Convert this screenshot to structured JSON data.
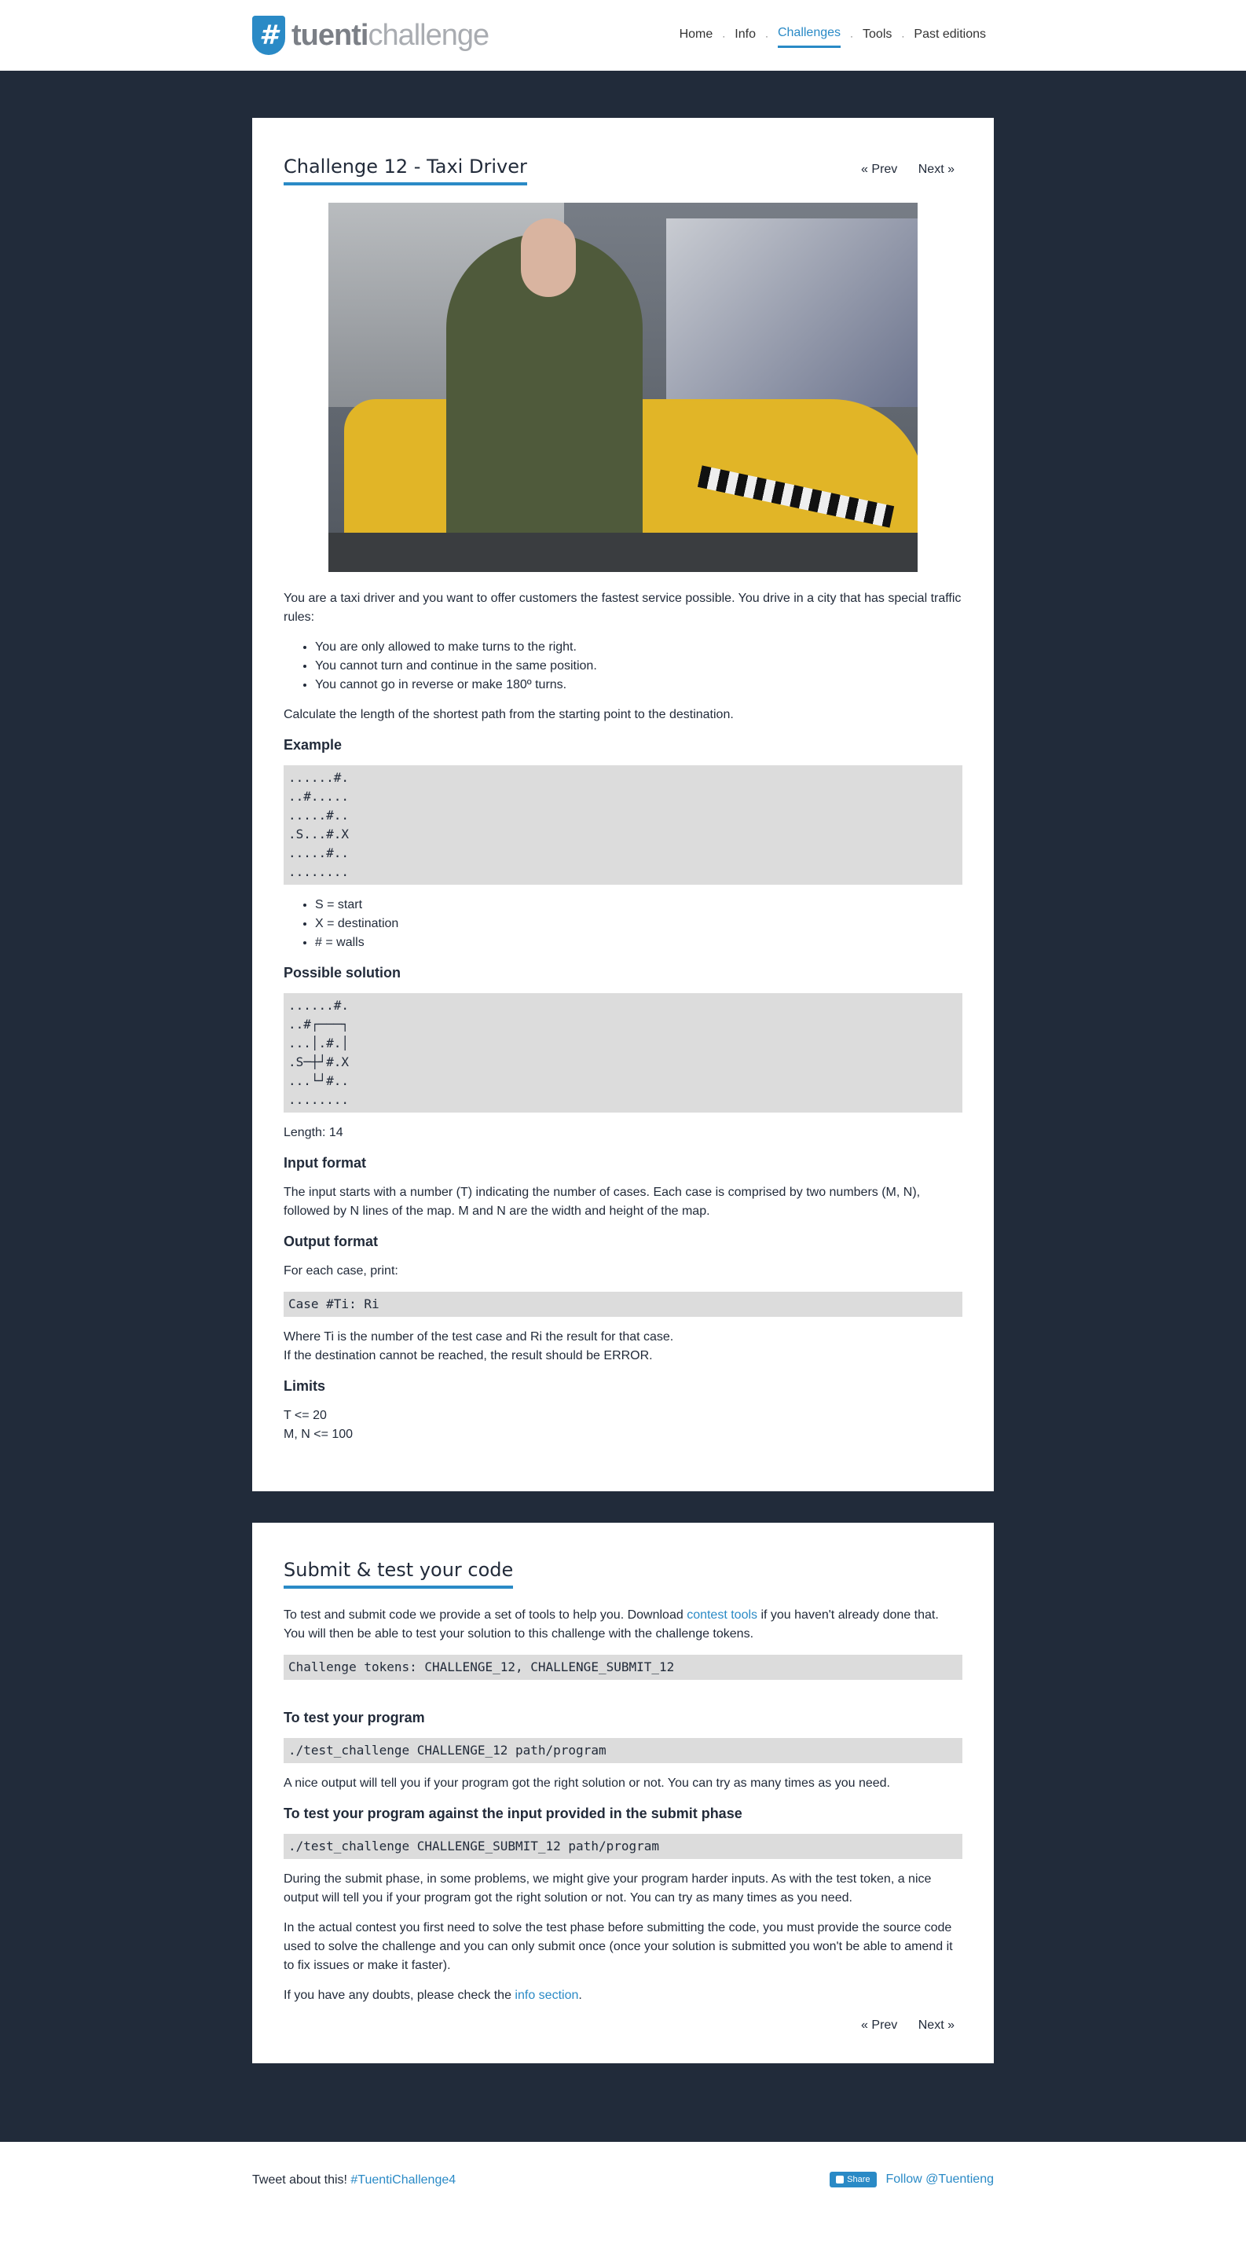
{
  "header": {
    "logo_text_bold": "tuenti",
    "logo_text_light": "challenge",
    "logo_symbol": "#",
    "nav": [
      {
        "label": "Home"
      },
      {
        "label": "Info"
      },
      {
        "label": "Challenges",
        "active": true
      },
      {
        "label": "Tools"
      },
      {
        "label": "Past editions"
      }
    ],
    "separator": "·"
  },
  "challenge": {
    "title": "Challenge 12 - Taxi Driver",
    "prev_label": "« Prev",
    "next_label": "Next »",
    "intro": "You are a taxi driver and you want to offer customers the fastest service possible. You drive in a city that has special traffic rules:",
    "rules": [
      "You are only allowed to make turns to the right.",
      "You cannot turn and continue in the same position.",
      "You cannot go in reverse or make 180º turns."
    ],
    "calc": "Calculate the length of the shortest path from the starting point to the destination.",
    "example_heading": "Example",
    "example_map": "......#.\n..#.....\n.....#..\n.S...#.X\n.....#..\n........",
    "legend": [
      "S = start",
      "X = destination",
      "# = walls"
    ],
    "solution_heading": "Possible solution",
    "solution_map": "......#.\n..#┌───┐\n...│.#.│\n.S─┼┘#.X\n...└┘#..\n........",
    "length": "Length: 14",
    "input_heading": "Input format",
    "input_text": "The input starts with a number (T) indicating the number of cases. Each case is comprised by two numbers (M, N), followed by N lines of the map. M and N are the width and height of the map.",
    "output_heading": "Output format",
    "output_text": "For each case, print:",
    "output_code": "Case #Ti: Ri",
    "where_text": "Where Ti is the number of the test case and Ri the result for that case.",
    "error_text": "If the destination cannot be reached, the result should be ERROR.",
    "limits_heading": "Limits",
    "limits": [
      "T <= 20",
      "M, N <= 100"
    ]
  },
  "submit": {
    "title": "Submit & test your code",
    "intro_before": "To test and submit code we provide a set of tools to help you. Download ",
    "intro_link": "contest tools",
    "intro_after": " if you haven't already done that. You will then be able to test your solution to this challenge with the challenge tokens.",
    "tokens_code": "Challenge tokens: CHALLENGE_12, CHALLENGE_SUBMIT_12",
    "test_heading": "To test your program",
    "test_code": "./test_challenge CHALLENGE_12 path/program",
    "test_text": "A nice output will tell you if your program got the right solution or not. You can try as many times as you need.",
    "submit_heading": "To test your program against the input provided in the submit phase",
    "submit_code": "./test_challenge CHALLENGE_SUBMIT_12 path/program",
    "submit_text": "During the submit phase, in some problems, we might give your program harder inputs. As with the test token, a nice output will tell you if your program got the right solution or not. You can try as many times as you need.",
    "contest_text": "In the actual contest you first need to solve the test phase before submitting the code, you must provide the source code used to solve the challenge and you can only submit once (once your solution is submitted you won't be able to amend it to fix issues or make it faster).",
    "doubts_before": "If you have any doubts, please check the ",
    "doubts_link": "info section",
    "doubts_after": ".",
    "prev_label": "« Prev",
    "next_label": "Next »"
  },
  "footer": {
    "tweet_text": "Tweet about this! ",
    "hashtag": "#TuentiChallenge4",
    "share_label": "Share",
    "follow_label": "Follow @Tuentieng"
  },
  "colors": {
    "accent": "#2a8ac6",
    "dark_bg": "#212b3a",
    "code_bg": "#dcdcdc"
  }
}
